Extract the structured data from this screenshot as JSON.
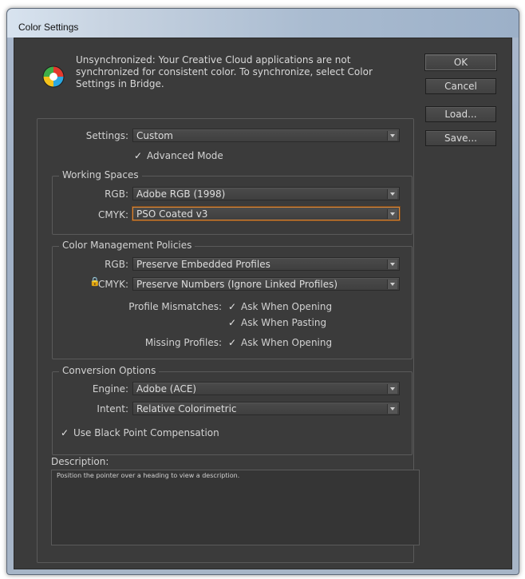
{
  "window": {
    "title": "Color Settings"
  },
  "message": {
    "text": "Unsynchronized: Your Creative Cloud applications are not synchronized for consistent color. To synchronize, select Color Settings in Bridge.",
    "icon": "color-wheel-icon"
  },
  "buttons": {
    "ok": "OK",
    "cancel": "Cancel",
    "load": "Load...",
    "save": "Save..."
  },
  "settings": {
    "label": "Settings:",
    "value": "Custom",
    "advanced_mode": "Advanced Mode",
    "advanced_checked": true
  },
  "working_spaces": {
    "title": "Working Spaces",
    "rgb_label": "RGB:",
    "rgb_value": "Adobe RGB (1998)",
    "cmyk_label": "CMYK:",
    "cmyk_value": "PSO Coated v3"
  },
  "policies": {
    "title": "Color Management Policies",
    "rgb_label": "RGB:",
    "rgb_value": "Preserve Embedded Profiles",
    "cmyk_label": "CMYK:",
    "cmyk_value": "Preserve Numbers (Ignore Linked Profiles)",
    "mismatch_label": "Profile Mismatches:",
    "ask_opening": "Ask When Opening",
    "ask_pasting": "Ask When Pasting",
    "missing_label": "Missing Profiles:",
    "missing_ask_opening": "Ask When Opening"
  },
  "conversion": {
    "title": "Conversion Options",
    "engine_label": "Engine:",
    "engine_value": "Adobe (ACE)",
    "intent_label": "Intent:",
    "intent_value": "Relative Colorimetric",
    "bpc": "Use Black Point Compensation"
  },
  "description": {
    "label": "Description:",
    "text": "Position the pointer over a heading to view a description."
  },
  "check_glyph": "✓",
  "lock_glyph": "🔒"
}
